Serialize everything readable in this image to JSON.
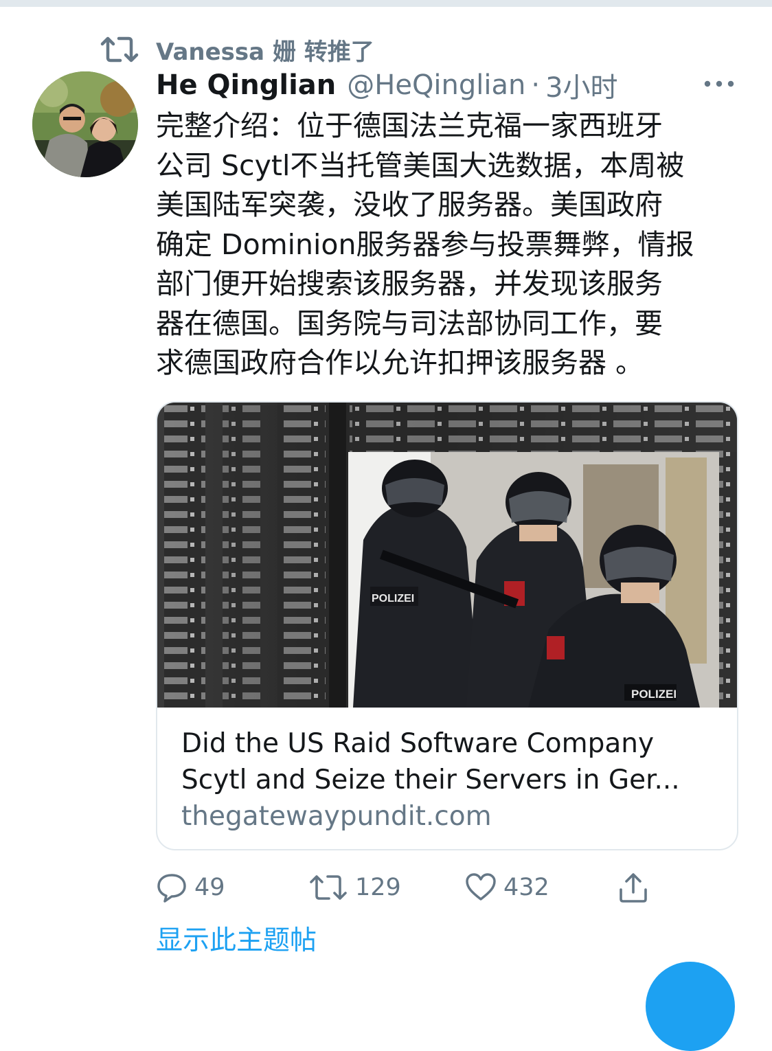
{
  "retweet": {
    "label": "Vanessa 姗 转推了"
  },
  "tweet": {
    "display_name": "He Qinglian",
    "handle": "@HeQinglian",
    "separator": "·",
    "time": "3小时",
    "text": "完整介绍：位于德国法兰克福一家西班牙\n公司 Scytl不当托管美国大选数据，本周被\n美国陆军突袭，没收了服务器。美国政府\n确定 Dominion服务器参与投票舞弊，情报\n部门便开始搜索该服务器，并发现该服务\n器在德国。国务院与司法部协同工作，要\n求德国政府合作以允许扣押该服务器 。"
  },
  "card": {
    "title_line1": "Did the US Raid Software Company",
    "title_line2": "Scytl and Seize their Servers in Ger...",
    "domain": "thegatewaypundit.com",
    "image_badges": [
      "POLIZEI",
      "POLIZEI"
    ]
  },
  "actions": {
    "reply_count": "49",
    "retweet_count": "129",
    "like_count": "432"
  },
  "show_thread": "显示此主题帖",
  "colors": {
    "accent": "#1da1f2",
    "secondary_text": "#657786",
    "border": "#e1e8ed"
  }
}
